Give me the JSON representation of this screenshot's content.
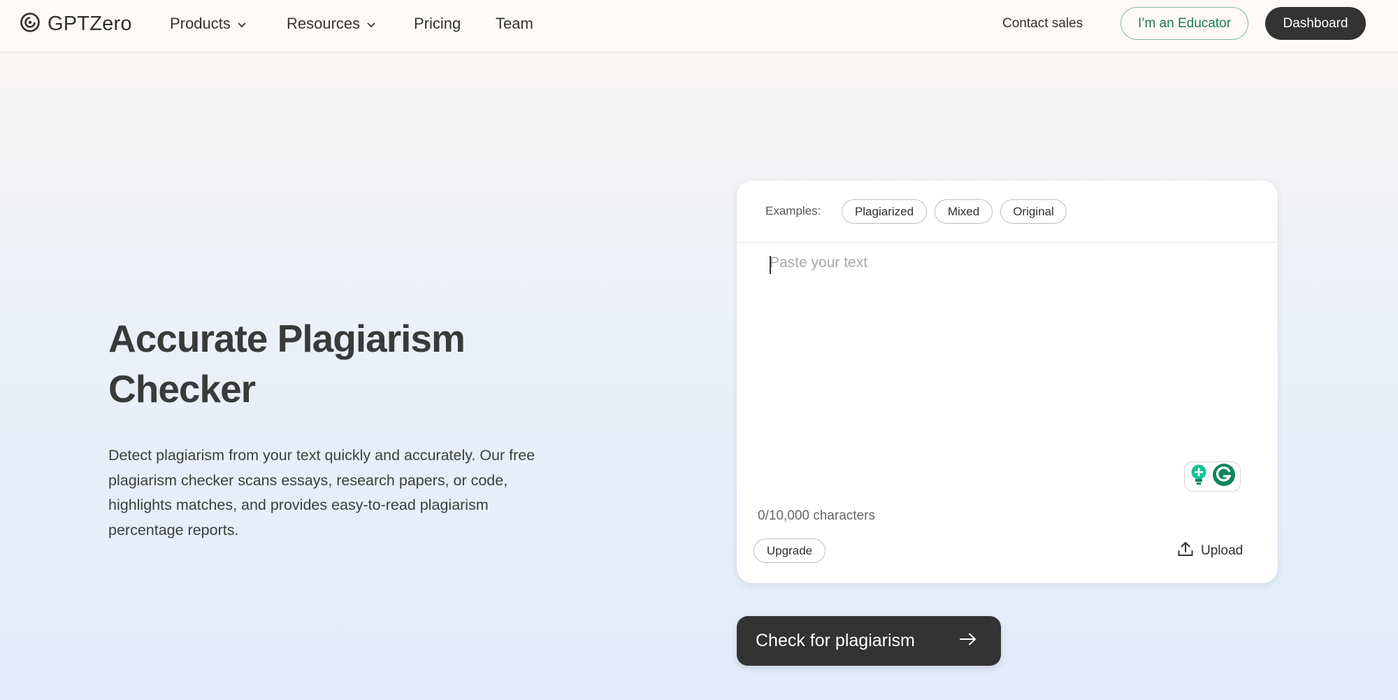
{
  "nav": {
    "logo_text": "GPTZero",
    "items": [
      {
        "label": "Products",
        "has_dropdown": true
      },
      {
        "label": "Resources",
        "has_dropdown": true
      },
      {
        "label": "Pricing",
        "has_dropdown": false
      },
      {
        "label": "Team",
        "has_dropdown": false
      }
    ],
    "contact_sales": "Contact sales",
    "educator_button": "I’m an Educator",
    "dashboard_button": "Dashboard"
  },
  "hero": {
    "title_line1": "Accurate Plagiarism",
    "title_line2": "Checker",
    "description_lines": [
      "Detect plagiarism from your text quickly and accurately. Our free",
      "plagiarism checker scans essays, research papers, or code,",
      "highlights matches, and provides easy-to-read plagiarism",
      "percentage reports."
    ]
  },
  "checker": {
    "examples_label": "Examples:",
    "examples": [
      "Plagiarized",
      "Mixed",
      "Original"
    ],
    "input_value": "",
    "input_placeholder": "Paste your text",
    "char_count": "0/10,000 characters",
    "upgrade_button": "Upgrade",
    "upload_button": "Upload",
    "submit_button": "Check for plagiarism"
  },
  "icons": {
    "logo": "gptzero-logo-icon",
    "dropdown": "chevron-down-icon",
    "grammarly_lightbulb": "lightbulb-icon",
    "grammarly_g": "grammarly-icon",
    "upload": "upload-icon",
    "submit_arrow": "arrow-right-icon"
  },
  "colors": {
    "primary_dark": "#333333",
    "educator_green": "#1f7a4d",
    "grammarly_green": "#15c39a",
    "grammarly_dark_green": "#11835f"
  }
}
